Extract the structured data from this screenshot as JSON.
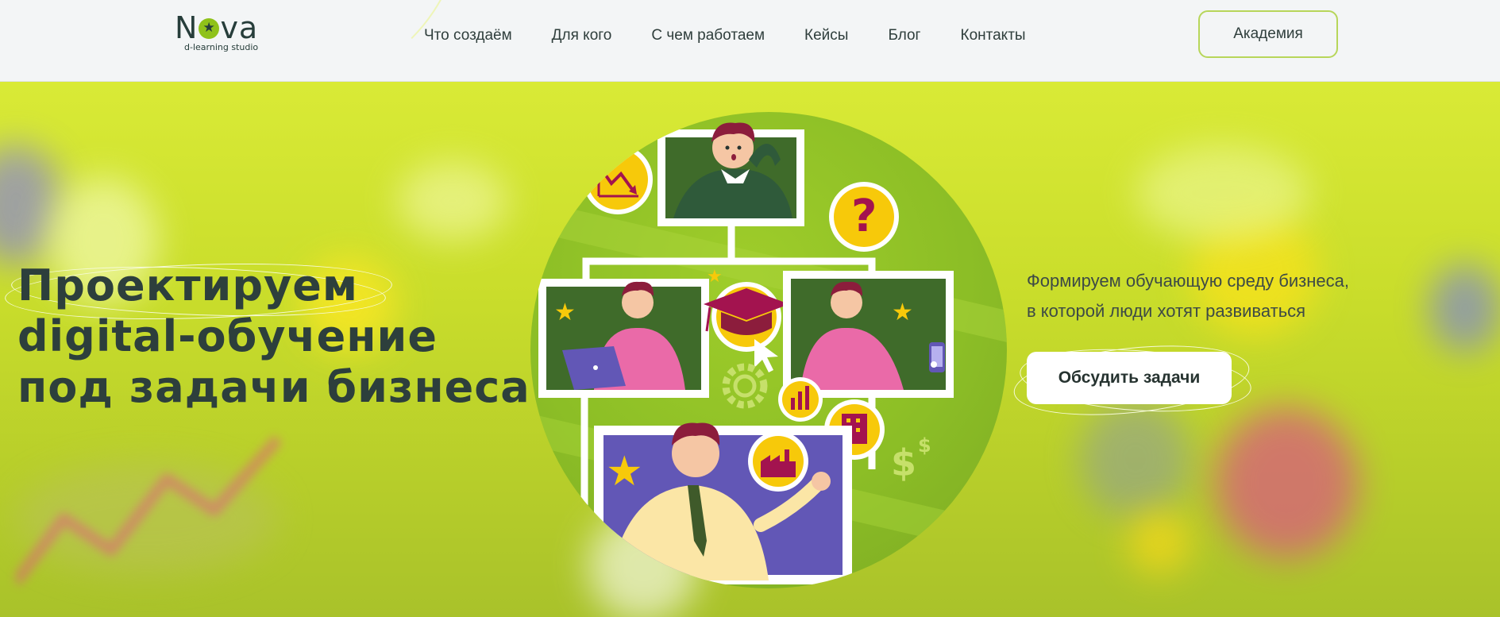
{
  "header": {
    "logo": {
      "wordmark": "NOVA",
      "tagline": "d-learning studio"
    },
    "nav": [
      {
        "label": "Что создаём"
      },
      {
        "label": "Для кого"
      },
      {
        "label": "С чем работаем"
      },
      {
        "label": "Кейсы"
      },
      {
        "label": "Блог"
      },
      {
        "label": "Контакты"
      }
    ],
    "academy_button": "Академия"
  },
  "hero": {
    "headline": [
      "Проектируем",
      "digital-обучение",
      "под задачи бизнеса"
    ],
    "subtitle": [
      "Формируем обучающую среду бизнеса,",
      "в которой люди хотят развиваться"
    ],
    "cta_button": "Обсудить задачи",
    "illustration": {
      "icons": [
        "chart-down-icon",
        "question-icon",
        "graduation-cap-icon",
        "gear-icon",
        "chart-up-icon",
        "building-icon",
        "factory-icon",
        "dollar-icon",
        "star-icon",
        "cursor-icon",
        "laptop-icon",
        "phone-icon"
      ]
    }
  },
  "colors": {
    "accent_lime": "#d4e82e",
    "dark_green_text": "#2d3f3c",
    "circle_green": "#8cbe26",
    "yellow": "#f7c90a",
    "magenta": "#a3134f",
    "purple": "#6257b6",
    "pink": "#ea6aa8"
  }
}
